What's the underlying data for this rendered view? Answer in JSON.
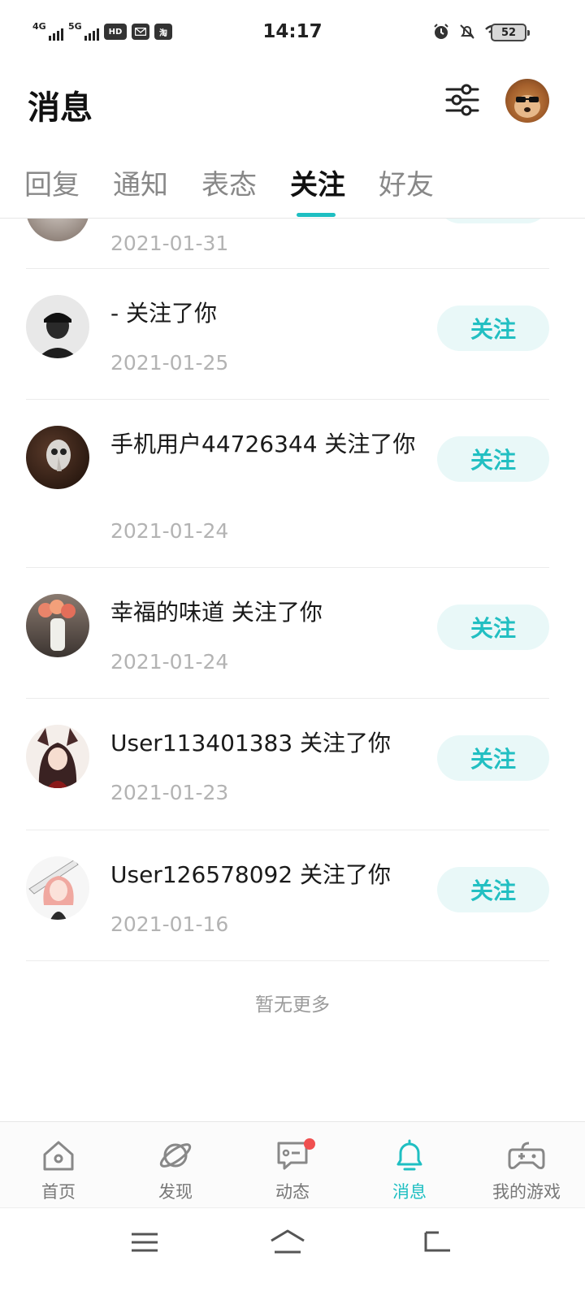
{
  "status_bar": {
    "time": "14:17",
    "signal1_label": "4G",
    "signal2_label": "5G",
    "hd_label": "HD",
    "taobao_label": "淘",
    "battery_level": "52"
  },
  "header": {
    "title": "消息"
  },
  "tabs": [
    {
      "label": "回复",
      "active": false
    },
    {
      "label": "通知",
      "active": false
    },
    {
      "label": "表态",
      "active": false
    },
    {
      "label": "关注",
      "active": true
    },
    {
      "label": "好友",
      "active": false
    }
  ],
  "follow_list": {
    "partial_top_date": "2021-01-31",
    "items": [
      {
        "text": "- 关注了你",
        "date": "2021-01-25",
        "button": "关注"
      },
      {
        "text": "手机用户44726344 关注了你",
        "date": "2021-01-24",
        "button": "关注"
      },
      {
        "text": "幸福的味道 关注了你",
        "date": "2021-01-24",
        "button": "关注"
      },
      {
        "text": "User113401383 关注了你",
        "date": "2021-01-23",
        "button": "关注"
      },
      {
        "text": "User126578092 关注了你",
        "date": "2021-01-16",
        "button": "关注"
      }
    ],
    "footer": "暂无更多"
  },
  "bottom_nav": [
    {
      "label": "首页",
      "icon": "home-icon",
      "active": false
    },
    {
      "label": "发现",
      "icon": "planet-icon",
      "active": false
    },
    {
      "label": "动态",
      "icon": "chat-icon",
      "active": false,
      "badge": true
    },
    {
      "label": "消息",
      "icon": "bell-icon",
      "active": true
    },
    {
      "label": "我的游戏",
      "icon": "gamepad-icon",
      "active": false
    }
  ],
  "colors": {
    "accent": "#1fbfc2",
    "follow_button_bg": "#e9f8f8",
    "date_text": "#b3b3b3",
    "badge": "#f05050"
  }
}
